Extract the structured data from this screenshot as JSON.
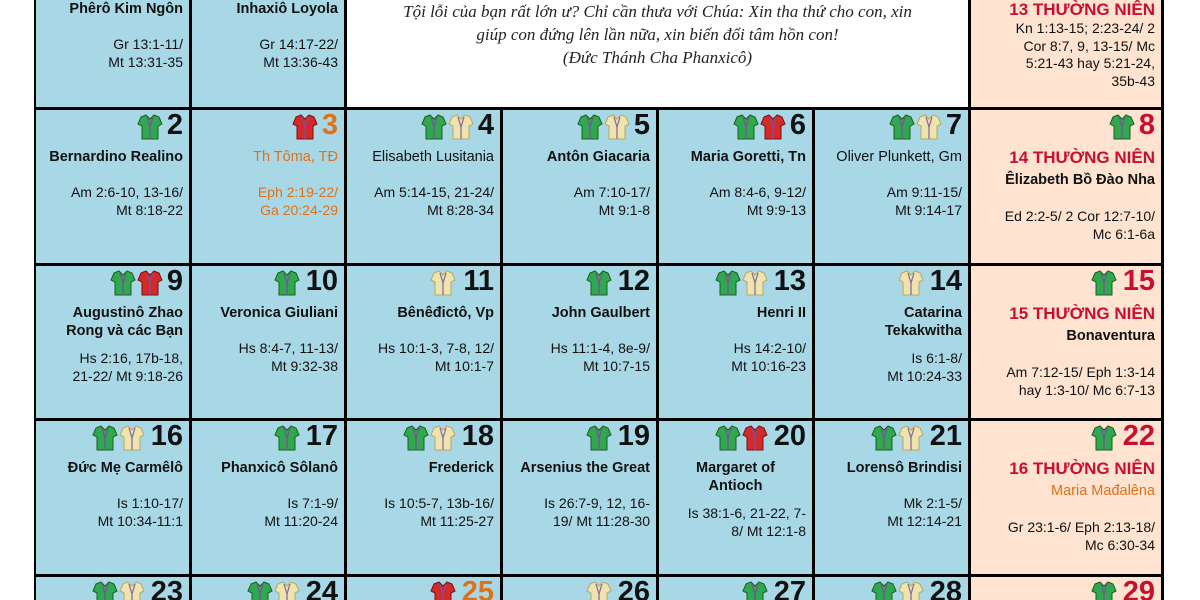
{
  "colors": {
    "weekday_cell": "#a8d8e6",
    "sunday_cell": "#fde3d0",
    "feast_red": "#c8102e",
    "optional_orange": "#e0701a",
    "vestment_green": "#2fa84f",
    "vestment_white": "#efe3b0",
    "vestment_red": "#d42a2a"
  },
  "top_row": {
    "cells": [
      {
        "saint": "Phêrô Kim Ngôn",
        "reading": [
          "Gr 13:1-11/",
          "Mt 13:31-35"
        ]
      },
      {
        "saint": "Inhaxiô Loyola",
        "reading": [
          "Gr 14:17-22/",
          "Mt 13:36-43"
        ]
      }
    ],
    "quote": {
      "lines": [
        "Tội lỗi của bạn rất lớn ư? Chỉ cần thưa với Chúa: Xin tha thứ cho con, xin",
        "giúp con đứng lên lần nữa, xin biến đổi tâm hồn con!",
        "(Đức Thánh Cha Phanxicô)"
      ]
    },
    "sunday": {
      "title": "13 THƯỜNG NIÊN",
      "reading": [
        "Kn 1:13-15; 2:23-24/ 2",
        "Cor 8:7, 9, 13-15/ Mc",
        "5:21-43 hay 5:21-24,",
        "35b-43"
      ]
    }
  },
  "weeks": [
    {
      "days": [
        {
          "day": "2",
          "day_style": "normal",
          "icons": [
            "green"
          ],
          "saint": "Bernardino Realino",
          "saint_style": "bold",
          "reading": [
            "Am 2:6-10, 13-16/",
            "Mt 8:18-22"
          ],
          "reading_style": "normal"
        },
        {
          "day": "3",
          "day_style": "orange",
          "icons": [
            "red"
          ],
          "saint": "Th Tôma, TĐ",
          "saint_style": "orange",
          "reading": [
            "Eph 2:19-22/",
            "Ga 20:24-29"
          ],
          "reading_style": "orange"
        },
        {
          "day": "4",
          "day_style": "normal",
          "icons": [
            "green",
            "white"
          ],
          "saint": "Elisabeth Lusitania",
          "saint_style": "plain",
          "reading": [
            "Am 5:14-15, 21-24/",
            "Mt 8:28-34"
          ],
          "reading_style": "normal"
        },
        {
          "day": "5",
          "day_style": "normal",
          "icons": [
            "green",
            "white"
          ],
          "saint": "Antôn Giacaria",
          "saint_style": "bold",
          "reading": [
            "Am 7:10-17/",
            "Mt 9:1-8"
          ],
          "reading_style": "normal"
        },
        {
          "day": "6",
          "day_style": "normal",
          "icons": [
            "green",
            "red"
          ],
          "saint": "Maria Goretti, Tn",
          "saint_style": "bold",
          "reading": [
            "Am 8:4-6, 9-12/",
            "Mt 9:9-13"
          ],
          "reading_style": "normal"
        },
        {
          "day": "7",
          "day_style": "normal",
          "icons": [
            "green",
            "white"
          ],
          "saint": "Oliver Plunkett, Gm",
          "saint_style": "plain",
          "reading": [
            "Am 9:11-15/",
            "Mt 9:14-17"
          ],
          "reading_style": "normal"
        }
      ],
      "sunday": {
        "day": "8",
        "icons": [
          "green"
        ],
        "title": "14 THƯỜNG NIÊN",
        "subtitle": "Êlizabeth Bồ Đào Nha",
        "subtitle_style": "bold",
        "reading": [
          "Ed 2:2-5/ 2 Cor 12:7-10/",
          "Mc 6:1-6a"
        ]
      }
    },
    {
      "days": [
        {
          "day": "9",
          "day_style": "normal",
          "icons": [
            "green",
            "red"
          ],
          "saint": "Augustinô Zhao\nRong và các Bạn",
          "saint_style": "bold",
          "reading": [
            "Hs 2:16, 17b-18,",
            "21-22/ Mt 9:18-26"
          ],
          "reading_style": "normal"
        },
        {
          "day": "10",
          "day_style": "normal",
          "icons": [
            "green"
          ],
          "saint": "Veronica Giuliani",
          "saint_style": "bold",
          "reading": [
            "Hs 8:4-7, 11-13/",
            "Mt 9:32-38"
          ],
          "reading_style": "normal"
        },
        {
          "day": "11",
          "day_style": "normal",
          "icons": [
            "white"
          ],
          "saint": "Bênêđictô, Vp",
          "saint_style": "bold",
          "reading": [
            "Hs 10:1-3, 7-8, 12/",
            "Mt 10:1-7"
          ],
          "reading_style": "normal"
        },
        {
          "day": "12",
          "day_style": "normal",
          "icons": [
            "green"
          ],
          "saint": "John Gaulbert",
          "saint_style": "bold",
          "reading": [
            "Hs 11:1-4, 8e-9/",
            "Mt 10:7-15"
          ],
          "reading_style": "normal"
        },
        {
          "day": "13",
          "day_style": "normal",
          "icons": [
            "green",
            "white"
          ],
          "saint": "Henri II",
          "saint_style": "bold",
          "reading": [
            "Hs 14:2-10/",
            "Mt 10:16-23"
          ],
          "reading_style": "normal"
        },
        {
          "day": "14",
          "day_style": "normal",
          "icons": [
            "white"
          ],
          "saint": "Catarina\nTekakwitha",
          "saint_style": "bold",
          "reading": [
            "Is 6:1-8/",
            "Mt 10:24-33"
          ],
          "reading_style": "normal"
        }
      ],
      "sunday": {
        "day": "15",
        "icons": [
          "green"
        ],
        "title": "15 THƯỜNG NIÊN",
        "subtitle": "Bonaventura",
        "subtitle_style": "bold",
        "reading": [
          "Am 7:12-15/ Eph 1:3-14",
          "hay 1:3-10/ Mc 6:7-13"
        ]
      }
    },
    {
      "days": [
        {
          "day": "16",
          "day_style": "normal",
          "icons": [
            "green",
            "white"
          ],
          "saint": "Đức Mẹ Carmêlô",
          "saint_style": "bold",
          "reading": [
            "Is 1:10-17/",
            "Mt 10:34-11:1"
          ],
          "reading_style": "normal"
        },
        {
          "day": "17",
          "day_style": "normal",
          "icons": [
            "green"
          ],
          "saint": "Phanxicô Sôlanô",
          "saint_style": "bold",
          "reading": [
            "Is 7:1-9/",
            "Mt 11:20-24"
          ],
          "reading_style": "normal"
        },
        {
          "day": "18",
          "day_style": "normal",
          "icons": [
            "green",
            "white"
          ],
          "saint": "Frederick",
          "saint_style": "bold",
          "reading": [
            "Is 10:5-7, 13b-16/",
            "Mt 11:25-27"
          ],
          "reading_style": "normal"
        },
        {
          "day": "19",
          "day_style": "normal",
          "icons": [
            "green"
          ],
          "saint": "Arsenius the Great",
          "saint_style": "bold",
          "reading": [
            "Is 26:7-9, 12, 16-",
            "19/ Mt 11:28-30"
          ],
          "reading_style": "normal"
        },
        {
          "day": "20",
          "day_style": "normal",
          "icons": [
            "green",
            "red"
          ],
          "saint": "Margaret of\nAntioch",
          "saint_style": "bold-center",
          "reading": [
            "Is 38:1-6, 21-22, 7-",
            "8/ Mt 12:1-8"
          ],
          "reading_style": "normal"
        },
        {
          "day": "21",
          "day_style": "normal",
          "icons": [
            "green",
            "white"
          ],
          "saint": "Lorensô Brindisi",
          "saint_style": "bold",
          "reading": [
            "Mk 2:1-5/",
            "Mt 12:14-21"
          ],
          "reading_style": "normal"
        }
      ],
      "sunday": {
        "day": "22",
        "icons": [
          "green"
        ],
        "title": "16 THƯỜNG NIÊN",
        "subtitle": "Maria Mađalêna",
        "subtitle_style": "orange",
        "reading": [
          "Gr 23:1-6/ Eph 2:13-18/",
          "Mc 6:30-34"
        ]
      }
    }
  ],
  "bottom_row": {
    "days": [
      {
        "day": "23",
        "day_style": "normal",
        "icons": [
          "green",
          "white"
        ]
      },
      {
        "day": "24",
        "day_style": "normal",
        "icons": [
          "green",
          "white"
        ]
      },
      {
        "day": "25",
        "day_style": "orange",
        "icons": [
          "red"
        ]
      },
      {
        "day": "26",
        "day_style": "normal",
        "icons": [
          "white"
        ]
      },
      {
        "day": "27",
        "day_style": "normal",
        "icons": [
          "green"
        ]
      },
      {
        "day": "28",
        "day_style": "normal",
        "icons": [
          "green",
          "white"
        ]
      }
    ],
    "sunday": {
      "day": "29",
      "icons": [
        "green"
      ]
    }
  }
}
